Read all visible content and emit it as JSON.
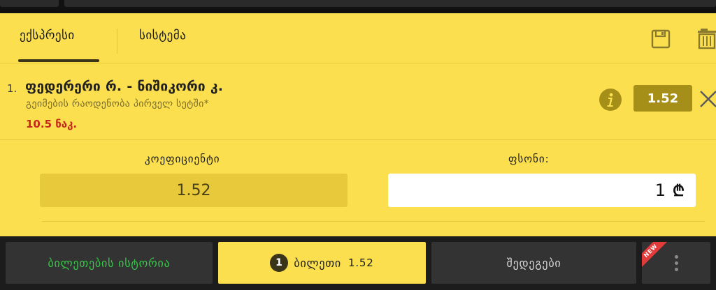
{
  "tabs": {
    "express": "ექსპრესი",
    "system": "სისტემა"
  },
  "toolbar": {
    "save_icon": "save-icon",
    "trash_icon": "trash-icon"
  },
  "bet": {
    "index": "1.",
    "match": "ფედერერი რ. - ნიშიკორი კ.",
    "market": "გეიმების რაოდენობა პირველ სეტში*",
    "selection": "10.5 ნაკ.",
    "odds": "1.52"
  },
  "coefficient": {
    "label": "კოეფიციენტი",
    "value": "1.52"
  },
  "stake": {
    "label": "ფსონი:",
    "value": "1",
    "currency": "₾"
  },
  "bottom_nav": {
    "history": "ბილეთების ისტორია",
    "ticket_count": "1",
    "ticket": "ბილეთი",
    "ticket_odds": "1.52",
    "results": "შედეგები",
    "new_badge": "NEW"
  },
  "colors": {
    "panel": "#fbdf4f",
    "odds_badge": "#a58f19",
    "pick": "#c6281b",
    "history_text": "#37c84a"
  }
}
